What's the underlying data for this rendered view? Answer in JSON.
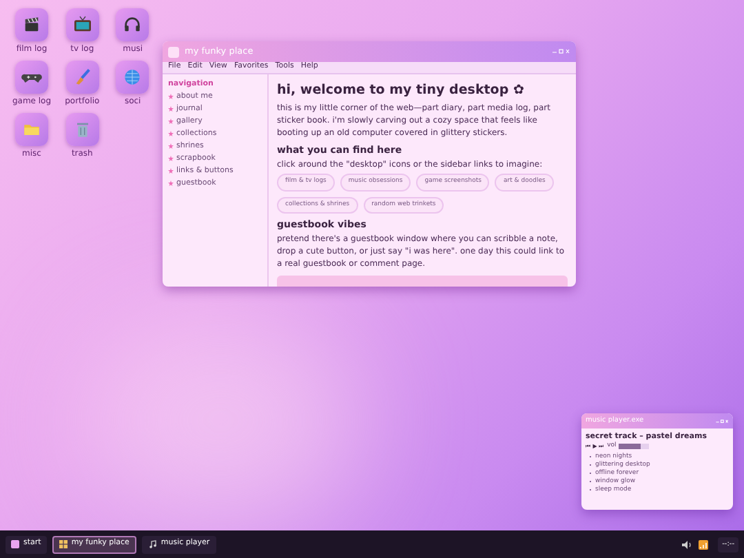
{
  "desktop_icons": [
    {
      "label": "film log",
      "kind": "film"
    },
    {
      "label": "tv log",
      "kind": "tv"
    },
    {
      "label": "musi",
      "kind": "headphones"
    },
    {
      "label": "game log",
      "kind": "gamepad"
    },
    {
      "label": "portfolio",
      "kind": "brush"
    },
    {
      "label": "soci",
      "kind": "globe"
    },
    {
      "label": "misc",
      "kind": "folder"
    },
    {
      "label": "trash",
      "kind": "trash"
    }
  ],
  "main_window": {
    "title": "my funky place",
    "menu": [
      "File",
      "Edit",
      "View",
      "Favorites",
      "Tools",
      "Help"
    ],
    "sidebar": {
      "heading": "navigation",
      "items": [
        "about me",
        "journal",
        "gallery",
        "collections",
        "shrines",
        "scrapbook",
        "links & buttons",
        "guestbook"
      ]
    },
    "heading": "hi, welcome to my tiny desktop ✿",
    "intro": "this is my little corner of the web—part diary, part media log, part sticker book. i'm slowly carving out a cozy space that feels like booting up an old computer covered in glittery stickers.",
    "sections": [
      {
        "title": "what you can find here",
        "text": "click around the \"desktop\" icons or the sidebar links to imagine:",
        "tags": [
          "film & tv logs",
          "music obsessions",
          "game screenshots",
          "art & doodles",
          "collections & shrines",
          "random web trinkets"
        ]
      },
      {
        "title": "guestbook vibes",
        "text": "pretend there's a guestbook window where you can scribble a note, drop a cute button, or just say \"i was here\". one day this could link to a real guestbook or comment page."
      }
    ]
  },
  "music_window": {
    "title": "music player.exe",
    "track": "secret track – pastel dreams",
    "controls": "⏮ ▶ ⏭",
    "volume_label": "vol",
    "volume": {
      "level": 0.72
    },
    "playlist": [
      "neon nights",
      "glittering desktop",
      "offline forever",
      "window glow",
      "sleep mode"
    ]
  },
  "taskbar": {
    "start": "start",
    "tasks": [
      {
        "label": "my funky place",
        "selected": true,
        "kind": "window"
      },
      {
        "label": "music player",
        "selected": false,
        "kind": "music"
      }
    ],
    "clock": "--:--"
  }
}
